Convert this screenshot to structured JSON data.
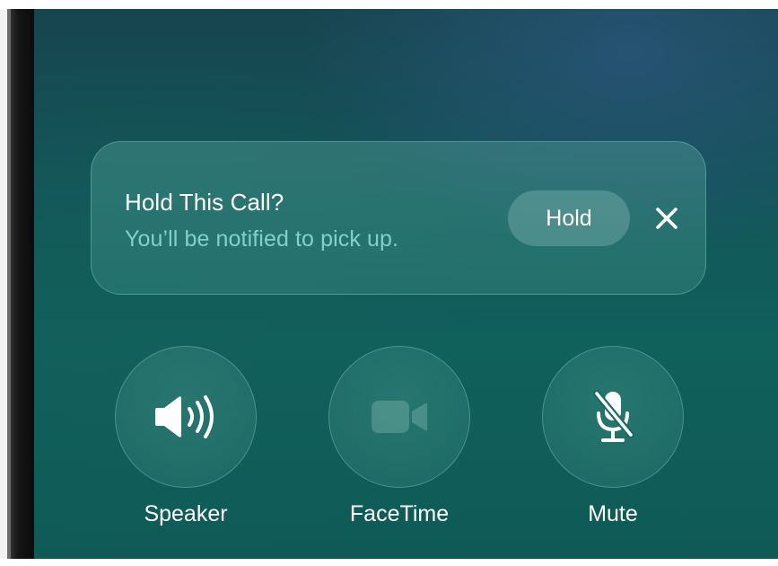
{
  "banner": {
    "title": "Hold This Call?",
    "subtitle": "You’ll be notified to pick up.",
    "hold_label": "Hold",
    "close_icon": "close-icon"
  },
  "controls": [
    {
      "label": "Speaker",
      "icon": "speaker-icon",
      "enabled": true
    },
    {
      "label": "FaceTime",
      "icon": "video-camera-icon",
      "enabled": false
    },
    {
      "label": "Mute",
      "icon": "microphone-slash-icon",
      "enabled": true
    }
  ],
  "colors": {
    "subtitle_accent": "#7fd3c6",
    "background_top": "#17454f",
    "background_bottom": "#0f5a56"
  }
}
